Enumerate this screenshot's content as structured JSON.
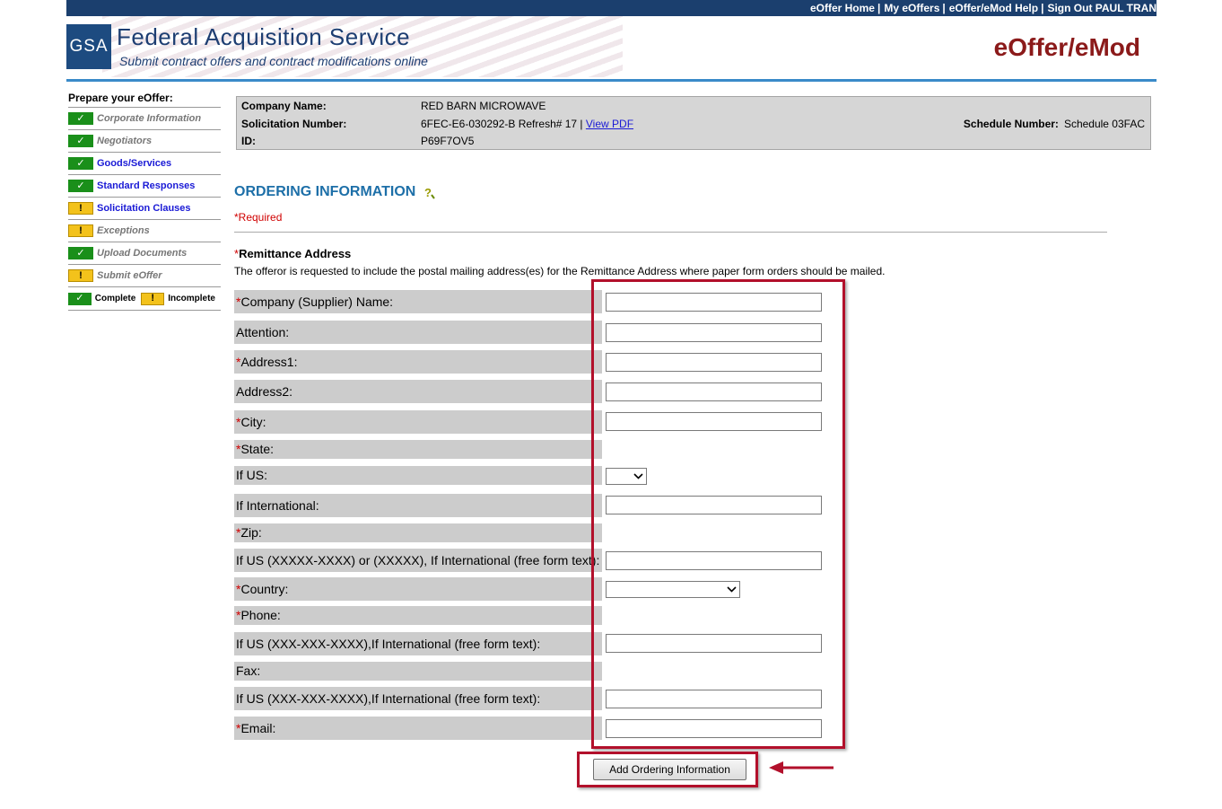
{
  "header": {
    "top_links": [
      "eOffer Home",
      "My eOffers",
      "eOffer/eMod Help",
      "Sign Out PAUL TRAN"
    ],
    "separator": "|",
    "logo_text": "GSA",
    "agency_title": "Federal Acquisition Service",
    "agency_subtitle": "Submit contract offers and contract modifications online",
    "product_name": "eOffer/eMod"
  },
  "sidebar": {
    "title": "Prepare your eOffer:",
    "items": [
      {
        "label": "Corporate Information",
        "status": "complete",
        "style": "grey"
      },
      {
        "label": "Negotiators",
        "status": "complete",
        "style": "grey"
      },
      {
        "label": "Goods/Services",
        "status": "complete",
        "style": "blue"
      },
      {
        "label": "Standard Responses",
        "status": "complete",
        "style": "blue"
      },
      {
        "label": "Solicitation Clauses",
        "status": "incomplete",
        "style": "blue"
      },
      {
        "label": "Exceptions",
        "status": "incomplete",
        "style": "grey"
      },
      {
        "label": "Upload Documents",
        "status": "complete",
        "style": "grey"
      },
      {
        "label": "Submit eOffer",
        "status": "incomplete",
        "style": "grey"
      }
    ],
    "legend": {
      "complete": "Complete",
      "incomplete": "Incomplete"
    },
    "icons": {
      "complete": "✓",
      "incomplete": "!"
    },
    "colors": {
      "complete": "#1a8f1a",
      "incomplete": "#f3c21b"
    }
  },
  "info": {
    "company_label": "Company Name:",
    "company_value": "RED BARN MICROWAVE",
    "solicitation_label": "Solicitation Number:",
    "solicitation_value": "6FEC-E6-030292-B Refresh# 17 |",
    "view_pdf": "View PDF",
    "id_label": "ID:",
    "id_value": "P69F7OV5",
    "schedule_label": "Schedule Number:",
    "schedule_value": "Schedule 03FAC"
  },
  "main": {
    "title": "ORDERING INFORMATION",
    "required_note": "*Required",
    "required_mark": "*",
    "section_title": "Remittance Address",
    "section_desc": "The offeror is requested to include the postal mailing address(es) for the Remittance Address where paper form orders should be mailed.",
    "fields": {
      "company": "Company (Supplier) Name:",
      "attention": "Attention:",
      "address1": "Address1:",
      "address2": "Address2:",
      "city": "City:",
      "state": "State:",
      "if_us": "If US:",
      "if_intl": "If International:",
      "zip": "Zip:",
      "zip_detail": "If US (XXXXX-XXXX) or (XXXXX), If International (free form text):",
      "country": "Country:",
      "phone": "Phone:",
      "phone_detail": "If US (XXX-XXX-XXXX),If International (free form text):",
      "fax": "Fax:",
      "fax_detail": "If US (XXX-XXX-XXXX),If International (free form text):",
      "email": "Email:"
    },
    "values": {
      "company": "",
      "attention": "",
      "address1": "",
      "address2": "",
      "city": "",
      "state_us": "",
      "state_intl": "",
      "zip": "",
      "country": "",
      "phone": "",
      "fax": "",
      "email": ""
    },
    "submit_button": "Add Ordering Information",
    "highlight_color": "#b2102b"
  }
}
